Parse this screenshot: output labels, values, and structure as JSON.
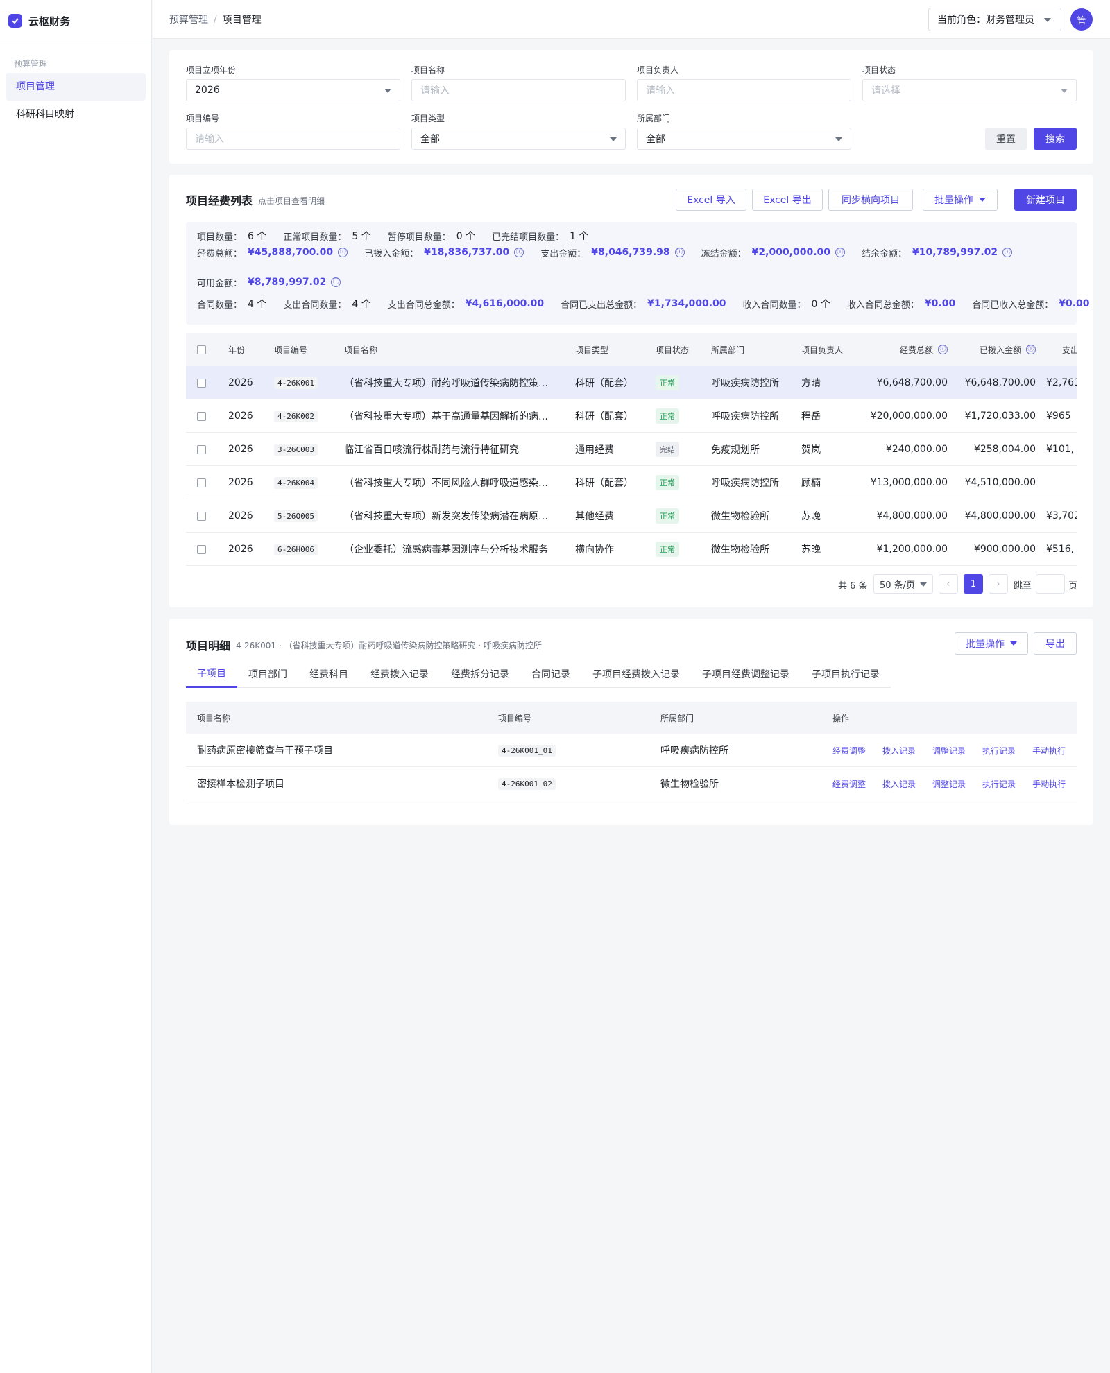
{
  "app": {
    "title": "云枢财务"
  },
  "sidebar": {
    "group": "预算管理",
    "items": [
      {
        "label": "项目管理",
        "active": true
      },
      {
        "label": "科研科目映射",
        "active": false
      }
    ]
  },
  "header": {
    "breadcrumb": [
      "预算管理",
      "项目管理"
    ],
    "separator": "/",
    "role_label": "当前角色：财务管理员",
    "avatar": "管"
  },
  "filters": {
    "year": {
      "label": "项目立项年份",
      "value": "2026"
    },
    "name": {
      "label": "项目名称",
      "placeholder": "请输入"
    },
    "owner": {
      "label": "项目负责人",
      "placeholder": "请输入"
    },
    "status": {
      "label": "项目状态",
      "placeholder": "请选择"
    },
    "code": {
      "label": "项目编号",
      "placeholder": "请输入"
    },
    "type": {
      "label": "项目类型",
      "value": "全部"
    },
    "dept": {
      "label": "所属部门",
      "value": "全部"
    },
    "reset": "重置",
    "search": "搜索"
  },
  "list": {
    "title": "项目经费列表",
    "hint": "点击项目查看明细",
    "actions": {
      "import": "Excel 导入",
      "export": "Excel 导出",
      "sync": "同步横向项目",
      "batch": "批量操作",
      "create": "新建项目"
    },
    "stats": {
      "row1": [
        {
          "k": "项目数量：",
          "v": "6 个"
        },
        {
          "k": "正常项目数量：",
          "v": "5 个"
        },
        {
          "k": "暂停项目数量：",
          "v": "0 个"
        },
        {
          "k": "已完结项目数量：",
          "v": "1 个"
        }
      ],
      "row2": [
        {
          "k": "经费总额：",
          "v": "¥45,888,700.00"
        },
        {
          "k": "已拨入金额：",
          "v": "¥18,836,737.00"
        },
        {
          "k": "支出金额：",
          "v": "¥8,046,739.98"
        },
        {
          "k": "冻结金额：",
          "v": "¥2,000,000.00"
        },
        {
          "k": "结余金额：",
          "v": "¥10,789,997.02"
        }
      ],
      "row3": [
        {
          "k": "可用金额：",
          "v": "¥8,789,997.02"
        }
      ],
      "row4": [
        {
          "k": "合同数量：",
          "v": "4 个"
        },
        {
          "k": "支出合同数量：",
          "v": "4 个"
        },
        {
          "k": "支出合同总金额：",
          "v": "¥4,616,000.00"
        },
        {
          "k": "合同已支出总金额：",
          "v": "¥1,734,000.00"
        },
        {
          "k": "收入合同数量：",
          "v": "0 个"
        },
        {
          "k": "收入合同总金额：",
          "v": "¥0.00"
        },
        {
          "k": "合同已收入总金额：",
          "v": "¥0.00"
        }
      ],
      "info_icon": "ⓘ"
    },
    "columns": [
      "年份",
      "项目编号",
      "项目名称",
      "项目类型",
      "项目状态",
      "所属部门",
      "项目负责人",
      "经费总额",
      "已拨入金额",
      "支出"
    ],
    "rows": [
      {
        "year": "2026",
        "code": "4-26K001",
        "name": "（省科技重大专项）耐药呼吸道传染病防控策…",
        "type": "科研（配套）",
        "status": "正常",
        "dept": "呼吸疾病防控所",
        "owner": "方晴",
        "total": "¥6,648,700.00",
        "funded": "¥6,648,700.00",
        "spent": "¥2,761"
      },
      {
        "year": "2026",
        "code": "4-26K002",
        "name": "（省科技重大专项）基于高通量基因解析的病…",
        "type": "科研（配套）",
        "status": "正常",
        "dept": "呼吸疾病防控所",
        "owner": "程岳",
        "total": "¥20,000,000.00",
        "funded": "¥1,720,033.00",
        "spent": "¥965"
      },
      {
        "year": "2026",
        "code": "3-26C003",
        "name": "临江省百日咳流行株耐药与流行特征研究",
        "type": "通用经费",
        "status": "完结",
        "dept": "免疫规划所",
        "owner": "贺岚",
        "total": "¥240,000.00",
        "funded": "¥258,004.00",
        "spent": "¥101,"
      },
      {
        "year": "2026",
        "code": "4-26K004",
        "name": "（省科技重大专项）不同风险人群呼吸道感染…",
        "type": "科研（配套）",
        "status": "正常",
        "dept": "呼吸疾病防控所",
        "owner": "顾楠",
        "total": "¥13,000,000.00",
        "funded": "¥4,510,000.00",
        "spent": ""
      },
      {
        "year": "2026",
        "code": "5-26Q005",
        "name": "（省科技重大专项）新发突发传染病潜在病原…",
        "type": "其他经费",
        "status": "正常",
        "dept": "微生物检验所",
        "owner": "苏晚",
        "total": "¥4,800,000.00",
        "funded": "¥4,800,000.00",
        "spent": "¥3,702"
      },
      {
        "year": "2026",
        "code": "6-26H006",
        "name": "（企业委托）流感病毒基因测序与分析技术服务",
        "type": "横向协作",
        "status": "正常",
        "dept": "微生物检验所",
        "owner": "苏晚",
        "total": "¥1,200,000.00",
        "funded": "¥900,000.00",
        "spent": "¥516,"
      }
    ],
    "pager": {
      "total": "共 6 条",
      "size": "50 条/页",
      "prev": "‹",
      "page": "1",
      "next": "›",
      "jump": "跳至",
      "unit": "页"
    }
  },
  "detail": {
    "title": "项目明细",
    "subtitle": "4-26K001 · （省科技重大专项）耐药呼吸道传染病防控策略研究 · 呼吸疾病防控所",
    "batch": "批量操作",
    "export": "导出",
    "tabs": [
      "子项目",
      "项目部门",
      "经费科目",
      "经费拨入记录",
      "经费拆分记录",
      "合同记录",
      "子项目经费拨入记录",
      "子项目经费调整记录",
      "子项目执行记录"
    ],
    "columns": [
      "项目名称",
      "项目编号",
      "所属部门",
      "操作"
    ],
    "rows": [
      {
        "name": "耐药病原密接筛查与干预子项目",
        "code": "4-26K001_01",
        "dept": "呼吸疾病防控所"
      },
      {
        "name": "密接样本检测子项目",
        "code": "4-26K001_02",
        "dept": "微生物检验所"
      }
    ],
    "ops": [
      "经费调整",
      "拨入记录",
      "调整记录",
      "执行记录",
      "手动执行"
    ]
  },
  "colors": {
    "accent": "#4f46e5",
    "ok": "#1f9d55"
  }
}
